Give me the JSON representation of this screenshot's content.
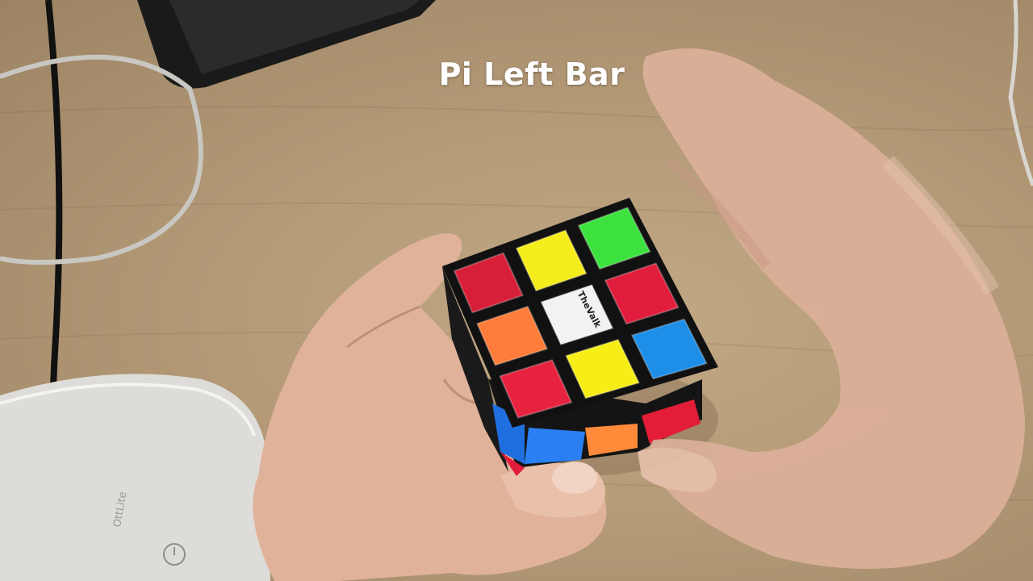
{
  "caption": "Pi Left Bar",
  "cube": {
    "logo": "TheValk",
    "top_face": [
      "#d81f3a",
      "#f5ec1c",
      "#3ee23f",
      "#ff7d3a",
      "#f2f2f2",
      "#e01d3d",
      "#e8233f",
      "#f6ee16",
      "#1e8fe8"
    ]
  },
  "lamp": {
    "brand": "OttLite",
    "icon": "power-icon"
  }
}
